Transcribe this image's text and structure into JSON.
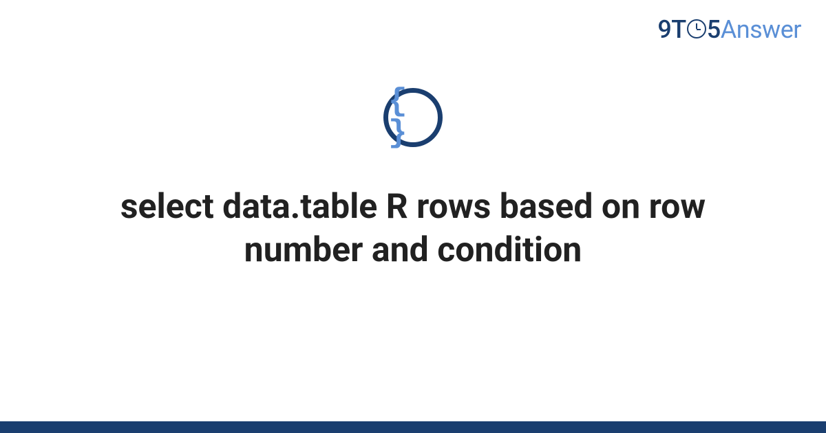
{
  "brand": {
    "part1": "9T",
    "part2": "5",
    "part3": "Answer"
  },
  "icon": {
    "glyph": "{ }"
  },
  "title": "select data.table R rows based on row number and condition"
}
